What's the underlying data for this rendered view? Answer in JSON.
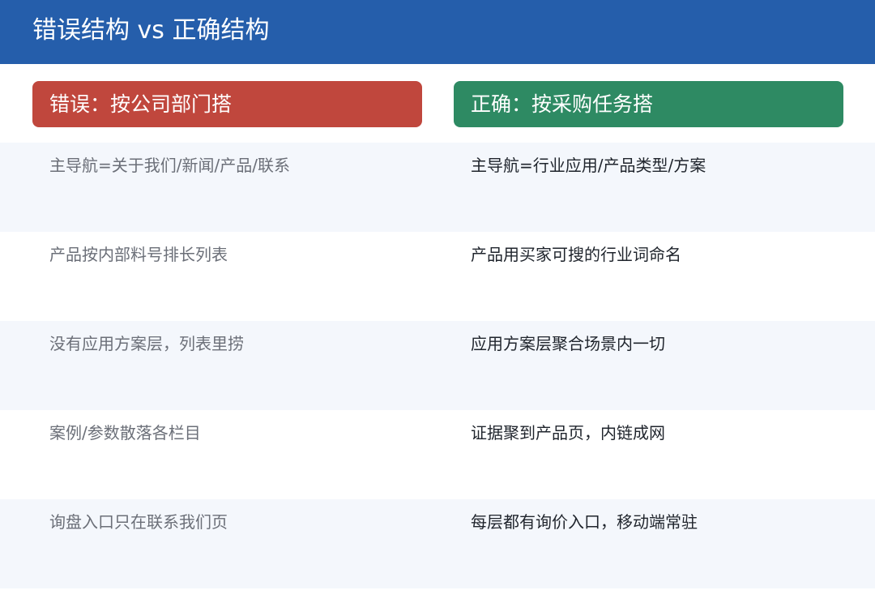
{
  "header": {
    "title": "错误结构 vs 正确结构",
    "background": "#255eab"
  },
  "columns": {
    "wrong": {
      "label": "错误：按公司部门搭",
      "color": "#c0473d"
    },
    "right": {
      "label": "正确：按采购任务搭",
      "color": "#2e8a63"
    }
  },
  "rows": [
    {
      "wrong": "主导航=关于我们/新闻/产品/联系",
      "right": "主导航=行业应用/产品类型/方案"
    },
    {
      "wrong": "产品按内部料号排长列表",
      "right": "产品用买家可搜的行业词命名"
    },
    {
      "wrong": "没有应用方案层，列表里捞",
      "right": "应用方案层聚合场景内一切"
    },
    {
      "wrong": "案例/参数散落各栏目",
      "right": "证据聚到产品页，内链成网"
    },
    {
      "wrong": "询盘入口只在联系我们页",
      "right": "每层都有询价入口，移动端常驻"
    }
  ],
  "stripe_color": "#f4f7fc"
}
